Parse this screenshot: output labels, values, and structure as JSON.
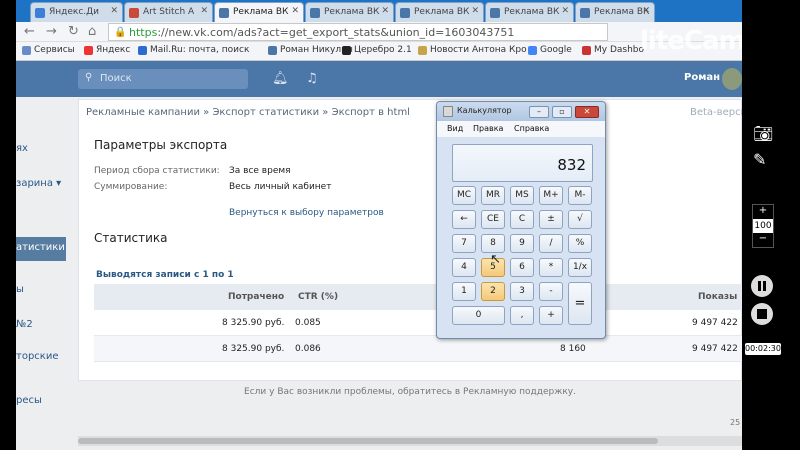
{
  "browser": {
    "tabs": [
      {
        "label": "Яндекс.Ди"
      },
      {
        "label": "Art Stitch A"
      },
      {
        "label": "Реклама ВК"
      },
      {
        "label": "Реклама ВК"
      },
      {
        "label": "Реклама ВК"
      },
      {
        "label": "Реклама ВК"
      },
      {
        "label": "Реклама ВК"
      }
    ],
    "url_scheme": "https",
    "url_rest": "://new.vk.com/ads?act=get_export_stats&union_id=1603043751",
    "bookmarks": [
      "Сервисы",
      "Яндекс",
      "Mail.Ru: почта, поиск",
      "Роман Никулин",
      "Церебро 2.1",
      "Новости Антона Кро",
      "Google",
      "My Dashbo"
    ]
  },
  "vk": {
    "search_placeholder": "Поиск",
    "user_name": "Роман",
    "sidebar": [
      "ях",
      "зарина ▾",
      "атистики",
      "ы",
      "№2",
      "торские",
      "ресы"
    ],
    "breadcrumb": "Рекламные кампании » Экспорт статистики » Экспорт в html",
    "beta": "Beta-верси",
    "params_title": "Параметры экспорта",
    "period_label": "Период сбора статистики:",
    "period_value": "За все время",
    "sum_label": "Суммирование:",
    "sum_value": "Весь личный кабинет",
    "back_link": "Вернуться к выбору параметров",
    "stats_title": "Статистика",
    "records": "Выводятся записи с 1 по 1",
    "headers": {
      "spent": "Потрачено",
      "ctr": "CTR (%)",
      "shows": "Показы"
    },
    "rows": [
      {
        "spent": "8 325.90 руб.",
        "ctr": "0.085",
        "mid": "",
        "shows": "9 497 422"
      },
      {
        "spent": "8 325.90 руб.",
        "ctr": "0.086",
        "mid": "8 160",
        "shows": "9 497 422"
      }
    ],
    "help": "Если у Вас возникли проблемы, обратитесь в Рекламную поддержку.",
    "page_num": "25"
  },
  "calculator": {
    "title": "Калькулятор",
    "menu": [
      "Вид",
      "Правка",
      "Справка"
    ],
    "display": "832",
    "keys": {
      "mc": "MC",
      "mr": "MR",
      "ms": "MS",
      "mplus": "M+",
      "mminus": "M-",
      "back": "←",
      "ce": "CE",
      "c": "C",
      "pm": "±",
      "sqrt": "√",
      "k7": "7",
      "k8": "8",
      "k9": "9",
      "div": "/",
      "pct": "%",
      "k4": "4",
      "k5": "5",
      "k6": "6",
      "mul": "*",
      "inv": "1/x",
      "k1": "1",
      "k2": "2",
      "k3": "3",
      "sub": "-",
      "eq": "=",
      "k0": "0",
      "dot": ",",
      "add": "+"
    }
  },
  "recorder": {
    "watermark": "liteCam",
    "zoom_value": "100",
    "zoom_plus": "+",
    "zoom_minus": "−",
    "timer": "00:02:30"
  }
}
